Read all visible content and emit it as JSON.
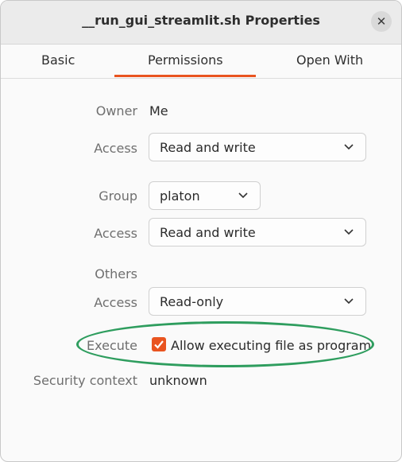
{
  "window": {
    "title": "__run_gui_streamlit.sh Properties"
  },
  "tabs": [
    {
      "label": "Basic",
      "active": false
    },
    {
      "label": "Permissions",
      "active": true
    },
    {
      "label": "Open With",
      "active": false
    }
  ],
  "accent_color": "#e95420",
  "annotation_color": "#2e9d5e",
  "owner": {
    "label": "Owner",
    "value": "Me"
  },
  "owner_access": {
    "label": "Access",
    "value": "Read and write"
  },
  "group": {
    "label": "Group",
    "value": "platon"
  },
  "group_access": {
    "label": "Access",
    "value": "Read and write"
  },
  "others": {
    "label": "Others"
  },
  "others_access": {
    "label": "Access",
    "value": "Read-only"
  },
  "execute": {
    "label": "Execute",
    "checkbox_label": "Allow executing file as program",
    "checked": true
  },
  "security": {
    "label": "Security context",
    "value": "unknown"
  }
}
